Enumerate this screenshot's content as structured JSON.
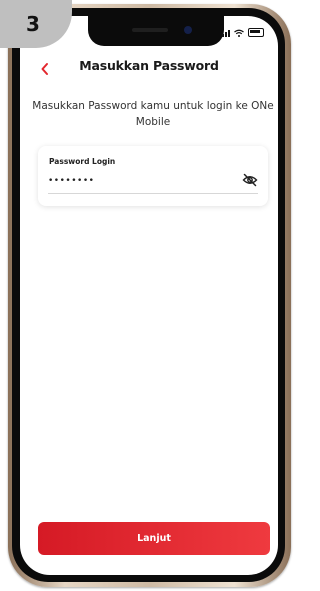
{
  "step_badge": "3",
  "header": {
    "back_icon": "chevron-left-icon",
    "title": "Masukkan Password"
  },
  "instruction": "Masukkan Password kamu untuk login ke ONe Mobile",
  "password_field": {
    "label": "Password Login",
    "value": "••••••••",
    "toggle_icon": "eye-off-icon"
  },
  "actions": {
    "next_label": "Lanjut"
  },
  "status_icons": [
    "signal-icon",
    "wifi-icon",
    "battery-icon"
  ],
  "colors": {
    "accent": "#e3262d",
    "title_text": "#1a1a1a",
    "body_text": "#333333"
  }
}
